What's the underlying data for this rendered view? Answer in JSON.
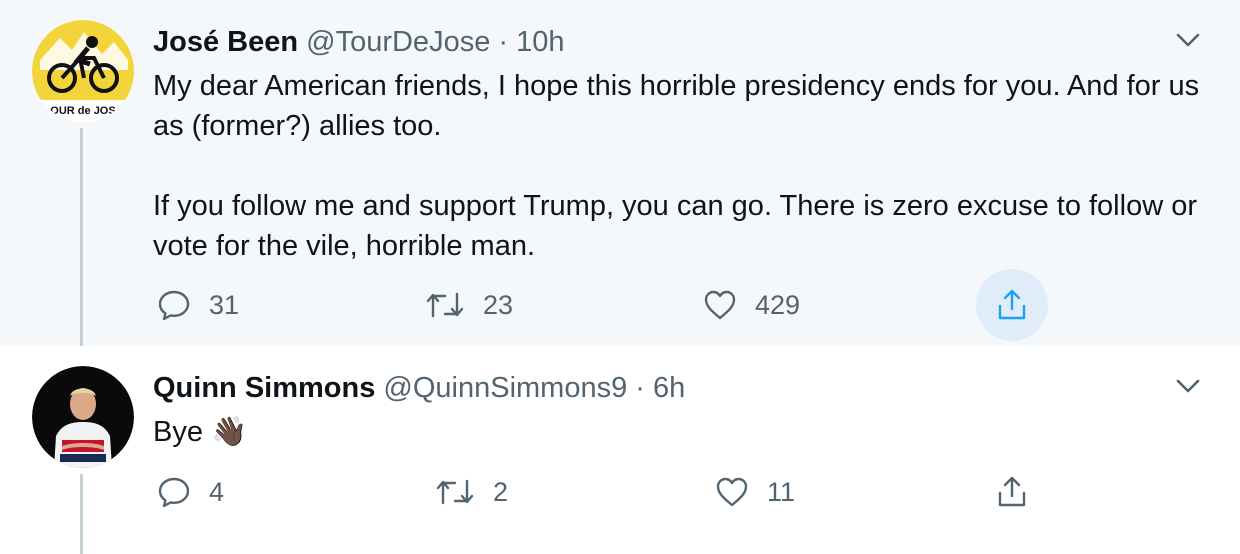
{
  "tweets": [
    {
      "name": "José Been",
      "handle": "@TourDeJose",
      "separator": "·",
      "time": "10h",
      "avatar_text": "OUR de JOS",
      "paragraphs": [
        "My dear American friends, I hope this horrible presidency ends for you. And for us as (former?) allies too.",
        "If you follow me and support Trump, you can go. There is zero excuse to follow or vote for the vile, horrible man."
      ],
      "replies": "31",
      "retweets": "23",
      "likes": "429"
    },
    {
      "name": "Quinn Simmons",
      "handle": "@QuinnSimmons9",
      "separator": "·",
      "time": "6h",
      "text": "Bye",
      "emoji": "👋🏿",
      "replies": "4",
      "retweets": "2",
      "likes": "11"
    }
  ],
  "icons": {
    "more": "chevron-down-icon",
    "reply": "reply-icon",
    "retweet": "retweet-icon",
    "like": "heart-icon",
    "share": "share-icon"
  },
  "colors": {
    "accent": "#1da1f2",
    "muted": "#536471",
    "highlight_bg": "#f5f8fa"
  }
}
